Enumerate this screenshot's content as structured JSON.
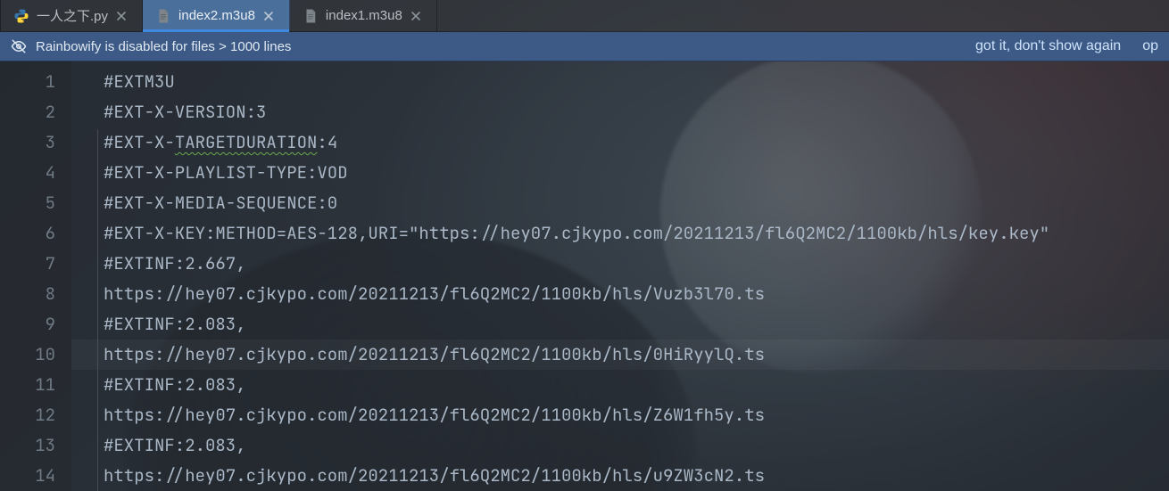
{
  "tabs": [
    {
      "label": "一人之下.py",
      "icon": "python-file-icon",
      "active": false
    },
    {
      "label": "index2.m3u8",
      "icon": "text-file-icon",
      "active": true
    },
    {
      "label": "index1.m3u8",
      "icon": "text-file-icon",
      "active": false
    }
  ],
  "notice": {
    "icon": "eye-off-icon",
    "message": "Rainbowify is disabled for files > 1000 lines",
    "actions": [
      "got it, don't show again",
      "op"
    ]
  },
  "editor": {
    "highlighted_line_index": 9,
    "line_numbers": [
      "1",
      "2",
      "3",
      "4",
      "5",
      "6",
      "7",
      "8",
      "9",
      "10",
      "11",
      "12",
      "13",
      "14"
    ],
    "line3": {
      "a": "#EXT-X-",
      "b": "TARGETDURATION",
      "c": ":4"
    },
    "lines": [
      "#EXTM3U",
      "#EXT-X-VERSION:3",
      "#EXT-X-TARGETDURATION:4",
      "#EXT-X-PLAYLIST-TYPE:VOD",
      "#EXT-X-MEDIA-SEQUENCE:0",
      "#EXT-X-KEY:METHOD=AES-128,URI=\"https://hey07.cjkypo.com/20211213/fl6Q2MC2/1100kb/hls/key.key\"",
      "#EXTINF:2.667,",
      "https://hey07.cjkypo.com/20211213/fl6Q2MC2/1100kb/hls/Vuzb3l70.ts",
      "#EXTINF:2.083,",
      "https://hey07.cjkypo.com/20211213/fl6Q2MC2/1100kb/hls/0HiRyylQ.ts",
      "#EXTINF:2.083,",
      "https://hey07.cjkypo.com/20211213/fl6Q2MC2/1100kb/hls/Z6W1fh5y.ts",
      "#EXTINF:2.083,",
      "https://hey07.cjkypo.com/20211213/fl6Q2MC2/1100kb/hls/u9ZW3cN2.ts"
    ]
  },
  "colors": {
    "tab_active_bg": "#4a6f9b",
    "tab_active_underline": "#3f8ae0",
    "notice_bg": "#3c5a85",
    "code_fg": "#a9b7c6",
    "gutter_fg": "#6f7a85"
  }
}
